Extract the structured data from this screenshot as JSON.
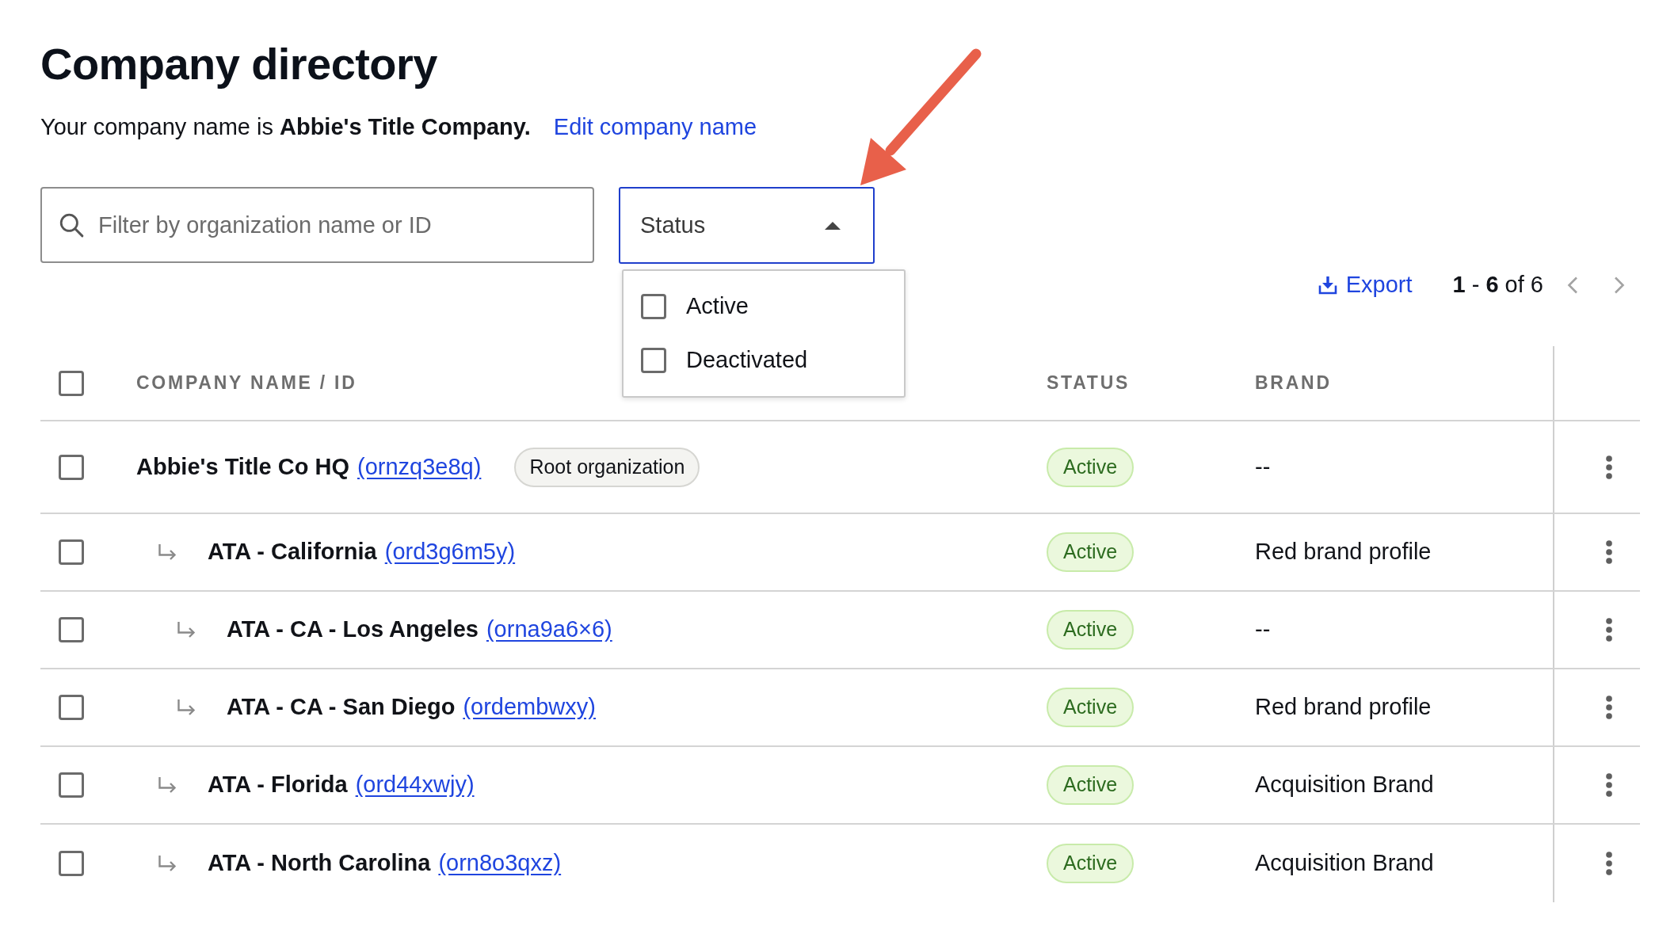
{
  "page": {
    "title": "Company directory"
  },
  "company_line": {
    "text": "Your company name is **Abbie's Title Company.**",
    "edit_link": "Edit company name"
  },
  "filters": {
    "search": {
      "placeholder": "Filter by organization name or ID"
    },
    "status": {
      "label": "Status",
      "expanded": true,
      "options": [
        {
          "label": "Active",
          "checked": false
        },
        {
          "label": "Deactivated",
          "checked": false
        }
      ]
    }
  },
  "toolbar": {
    "export": "Export",
    "range": "**1** - **6** of 6",
    "prev": {
      "disabled": true
    },
    "next": {
      "disabled": true
    }
  },
  "table": {
    "select_all": {
      "checked": false
    },
    "columns": [
      "COMPANY NAME / ID",
      "STATUS",
      "BRAND"
    ],
    "rows": [
      {
        "name": "Abbie's Title Co HQ",
        "id": "(ornzq3e8q)",
        "badge": "Root organization",
        "status": "Active",
        "brand": "--",
        "checked": false,
        "children": [
          {
            "name": "ATA - California",
            "id": "(ord3g6m5y)",
            "status": "Active",
            "brand": "Red brand profile",
            "checked": false,
            "children": [
              {
                "name": "ATA - CA - Los Angeles",
                "id": "(orna9a6×6)",
                "status": "Active",
                "brand": "--",
                "checked": false
              },
              {
                "name": "ATA - CA - San Diego",
                "id": "(ordembwxy)",
                "status": "Active",
                "brand": "Red brand profile",
                "checked": false
              }
            ]
          },
          {
            "name": "ATA - Florida",
            "id": "(ord44xwjy)",
            "status": "Active",
            "brand": "Acquisition Brand",
            "checked": false
          },
          {
            "name": "ATA - North Carolina",
            "id": "(orn8o3qxz)",
            "status": "Active",
            "brand": "Acquisition Brand",
            "checked": false
          }
        ]
      }
    ]
  }
}
